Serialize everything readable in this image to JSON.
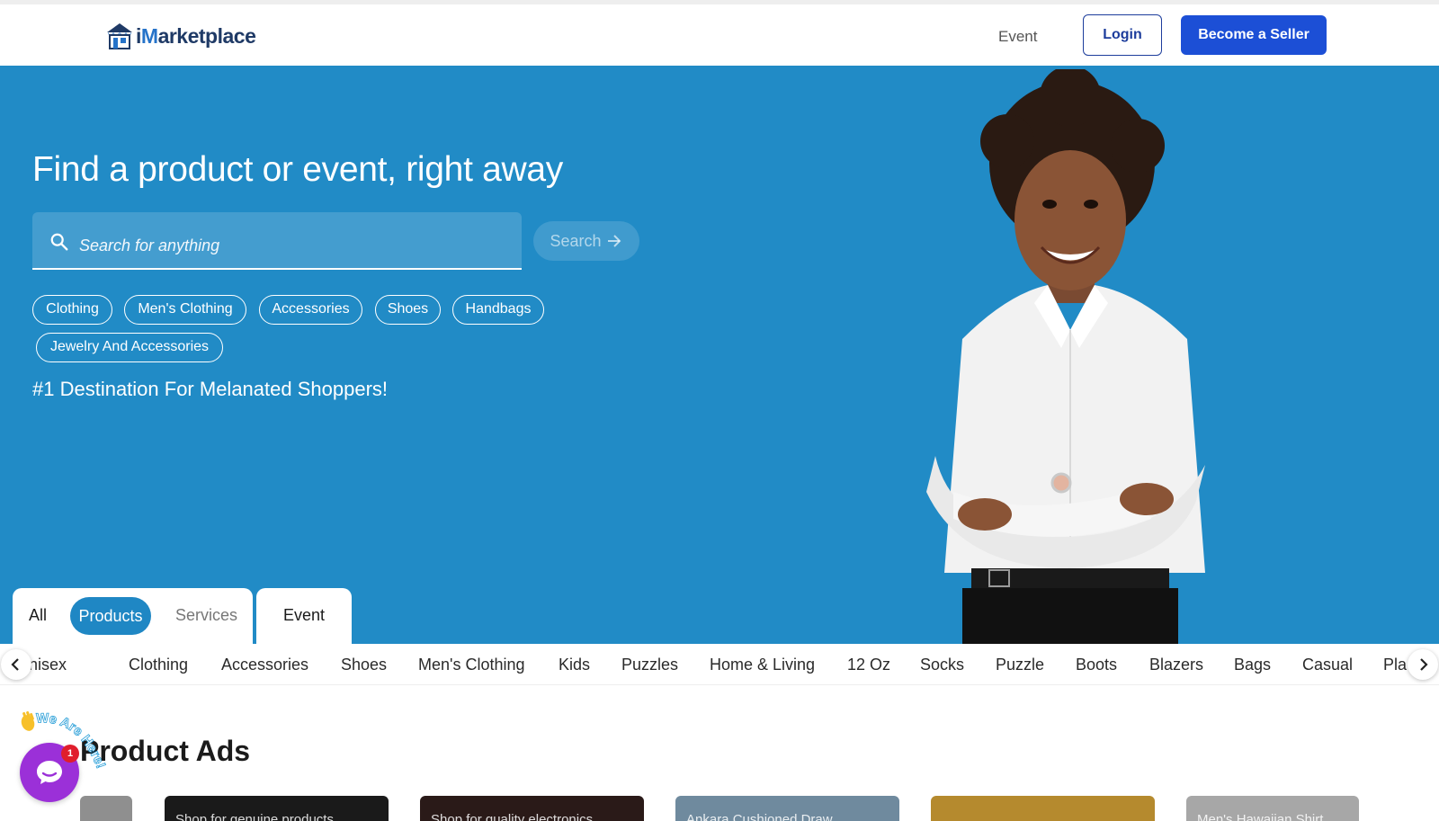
{
  "header": {
    "logo_prefix": "i",
    "logo_m": "M",
    "logo_rest": "arketplace",
    "nav_event": "Event",
    "login": "Login",
    "become_seller": "Become a Seller"
  },
  "hero": {
    "title": "Find a product or event, right away",
    "search_placeholder": "Search for anything",
    "search_button": "Search",
    "chips": [
      "Clothing",
      "Men's Clothing",
      "Accessories",
      "Shoes",
      "Handbags",
      "Jewelry And Accessories"
    ],
    "tagline": "#1 Destination For Melanated Shoppers!"
  },
  "tabs": {
    "all": "All",
    "products": "Products",
    "services": "Services",
    "event": "Event"
  },
  "categories": [
    "nisex",
    "Clothing",
    "Accessories",
    "Shoes",
    "Men's Clothing",
    "Kids",
    "Puzzles",
    "Home & Living",
    "12 Oz",
    "Socks",
    "Puzzle",
    "Boots",
    "Blazers",
    "Bags",
    "Casual",
    "Pla"
  ],
  "ads": {
    "title": "Product Ads",
    "cards": [
      "",
      "Shop for genuine products",
      "Shop for quality electronics",
      "Ankara Cushioned Draw",
      "",
      "Men's Hawaiian Shirt"
    ]
  },
  "chat": {
    "wave_text": "We Are Here!",
    "badge": "1"
  },
  "colors": {
    "hero_bg": "#218bc6",
    "primary_button": "#1c4fd6",
    "active_tab": "#1f87c4",
    "chat_bubble": "#9b30d8"
  }
}
